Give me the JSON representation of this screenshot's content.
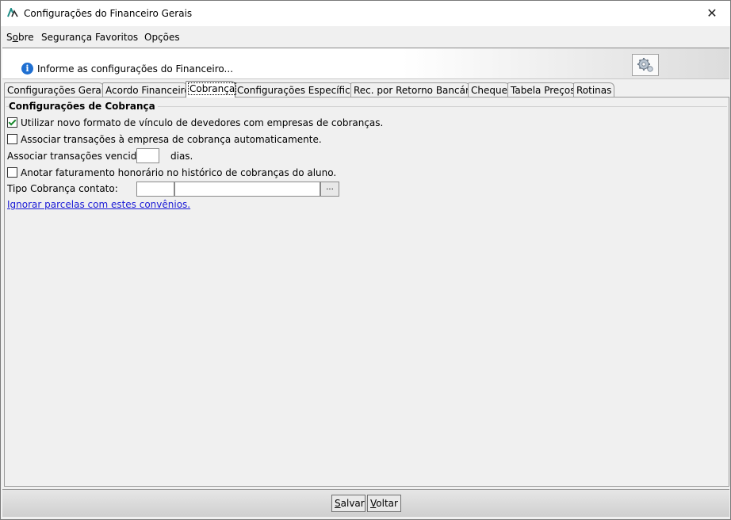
{
  "window": {
    "title": "Configurações do Financeiro Gerais",
    "close_symbol": "✕"
  },
  "menu": {
    "items": [
      {
        "label_pre": "S",
        "label_accel": "o",
        "label_post": "bre"
      },
      {
        "label": "Segurança"
      },
      {
        "label": "Favoritos"
      },
      {
        "label": "Opções"
      }
    ]
  },
  "header": {
    "info_glyph": "i",
    "info_text": "Informe as configurações do Financeiro..."
  },
  "tabs": [
    {
      "label": "Configurações Gerais"
    },
    {
      "label": "Acordo Financeiro"
    },
    {
      "label": "Cobrança",
      "active": true
    },
    {
      "label": "Configurações Específicas"
    },
    {
      "label": "Rec. por Retorno Bancário"
    },
    {
      "label": "Cheque"
    },
    {
      "label": "Tabela Preços"
    },
    {
      "label": "Rotinas"
    }
  ],
  "cobranca": {
    "group_title": "Configurações de Cobrança",
    "opt_novo_formato": {
      "label": "Utilizar novo formato de vínculo de devedores com empresas de cobranças.",
      "checked": true
    },
    "opt_associar": {
      "label": "Associar transações à empresa de cobrança automaticamente.",
      "checked": false
    },
    "vencidas": {
      "label_before": "Associar transações vencidas a",
      "value": "",
      "label_after": "dias."
    },
    "opt_anotar": {
      "label": "Anotar faturamento honorário no histórico de cobranças do aluno.",
      "checked": false
    },
    "tipo_cobranca": {
      "label": "Tipo Cobrança contato:",
      "code_value": "",
      "desc_value": "",
      "button_label": "..."
    },
    "ignorar_link": "Ignorar parcelas com estes convênios."
  },
  "footer": {
    "save": {
      "accel": "S",
      "rest": "alvar"
    },
    "back": {
      "accel": "V",
      "rest": "oltar"
    }
  },
  "colors": {
    "link": "#1a1ad6",
    "info_icon": "#1f6fd1",
    "check": "#1b8a2f"
  }
}
